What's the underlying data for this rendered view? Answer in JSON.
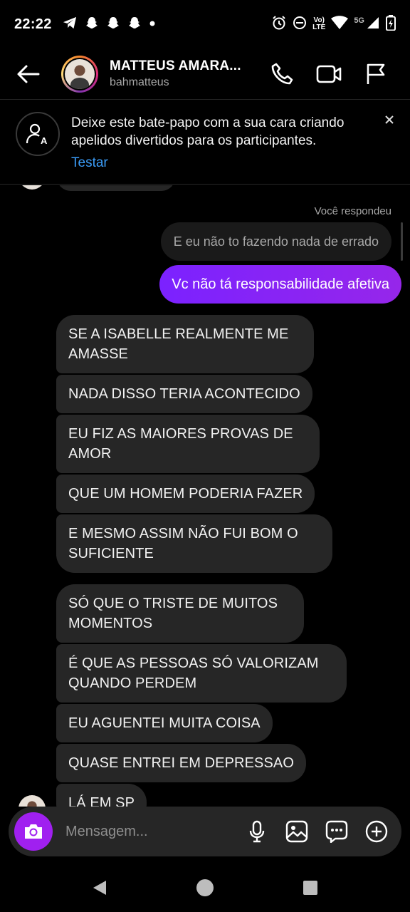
{
  "status_bar": {
    "time": "22:22",
    "network_top": "Vo)",
    "network_bottom": "LTE",
    "signal_label": "5G"
  },
  "header": {
    "name": "MATTEUS AMARA...",
    "username": "bahmatteus"
  },
  "banner": {
    "text": "Deixe este bate-papo com a sua cara criando apelidos divertidos para os participantes.",
    "action": "Testar"
  },
  "chat": {
    "replied_label": "Você respondeu",
    "quoted_text": "E eu não to fazendo nada de errado",
    "sent_message": "Vc não tá responsabilidade afetiva",
    "received_group1": [
      "SE A ISABELLE REALMENTE ME AMASSE",
      "NADA DISSO TERIA ACONTECIDO",
      "EU FIZ AS MAIORES PROVAS DE AMOR",
      "QUE UM HOMEM PODERIA FAZER",
      "E MESMO ASSIM NÃO FUI BOM O SUFICIENTE"
    ],
    "received_group2": [
      "SÓ QUE O TRISTE DE MUITOS MOMENTOS",
      "É QUE AS PESSOAS SÓ VALORIZAM QUANDO PERDEM",
      "EU AGUENTEI MUITA COISA",
      "QUASE ENTREI EM DEPRESSAO",
      "LÁ EM SP"
    ]
  },
  "composer": {
    "placeholder": "Mensagem..."
  },
  "colors": {
    "background": "#000000",
    "received_bubble": "#262626",
    "sent_bubble_start": "#7b22ff",
    "sent_bubble_end": "#9626ea",
    "camera_button": "#a020f0",
    "link": "#3b9cf7"
  },
  "icons": {
    "status": [
      "telegram-icon",
      "snapchat-icon",
      "snapchat-icon",
      "snapchat-icon",
      "dot-icon",
      "alarm-icon",
      "dnd-icon",
      "wifi-icon",
      "signal-icon",
      "battery-icon"
    ],
    "header": [
      "back-arrow-icon",
      "phone-icon",
      "video-camera-icon",
      "flag-icon"
    ],
    "banner": [
      "user-nickname-icon",
      "close-icon"
    ],
    "composer": [
      "camera-icon",
      "microphone-icon",
      "gallery-icon",
      "sticker-icon",
      "plus-icon"
    ],
    "nav": [
      "back-triangle-icon",
      "home-circle-icon",
      "recents-square-icon"
    ]
  }
}
